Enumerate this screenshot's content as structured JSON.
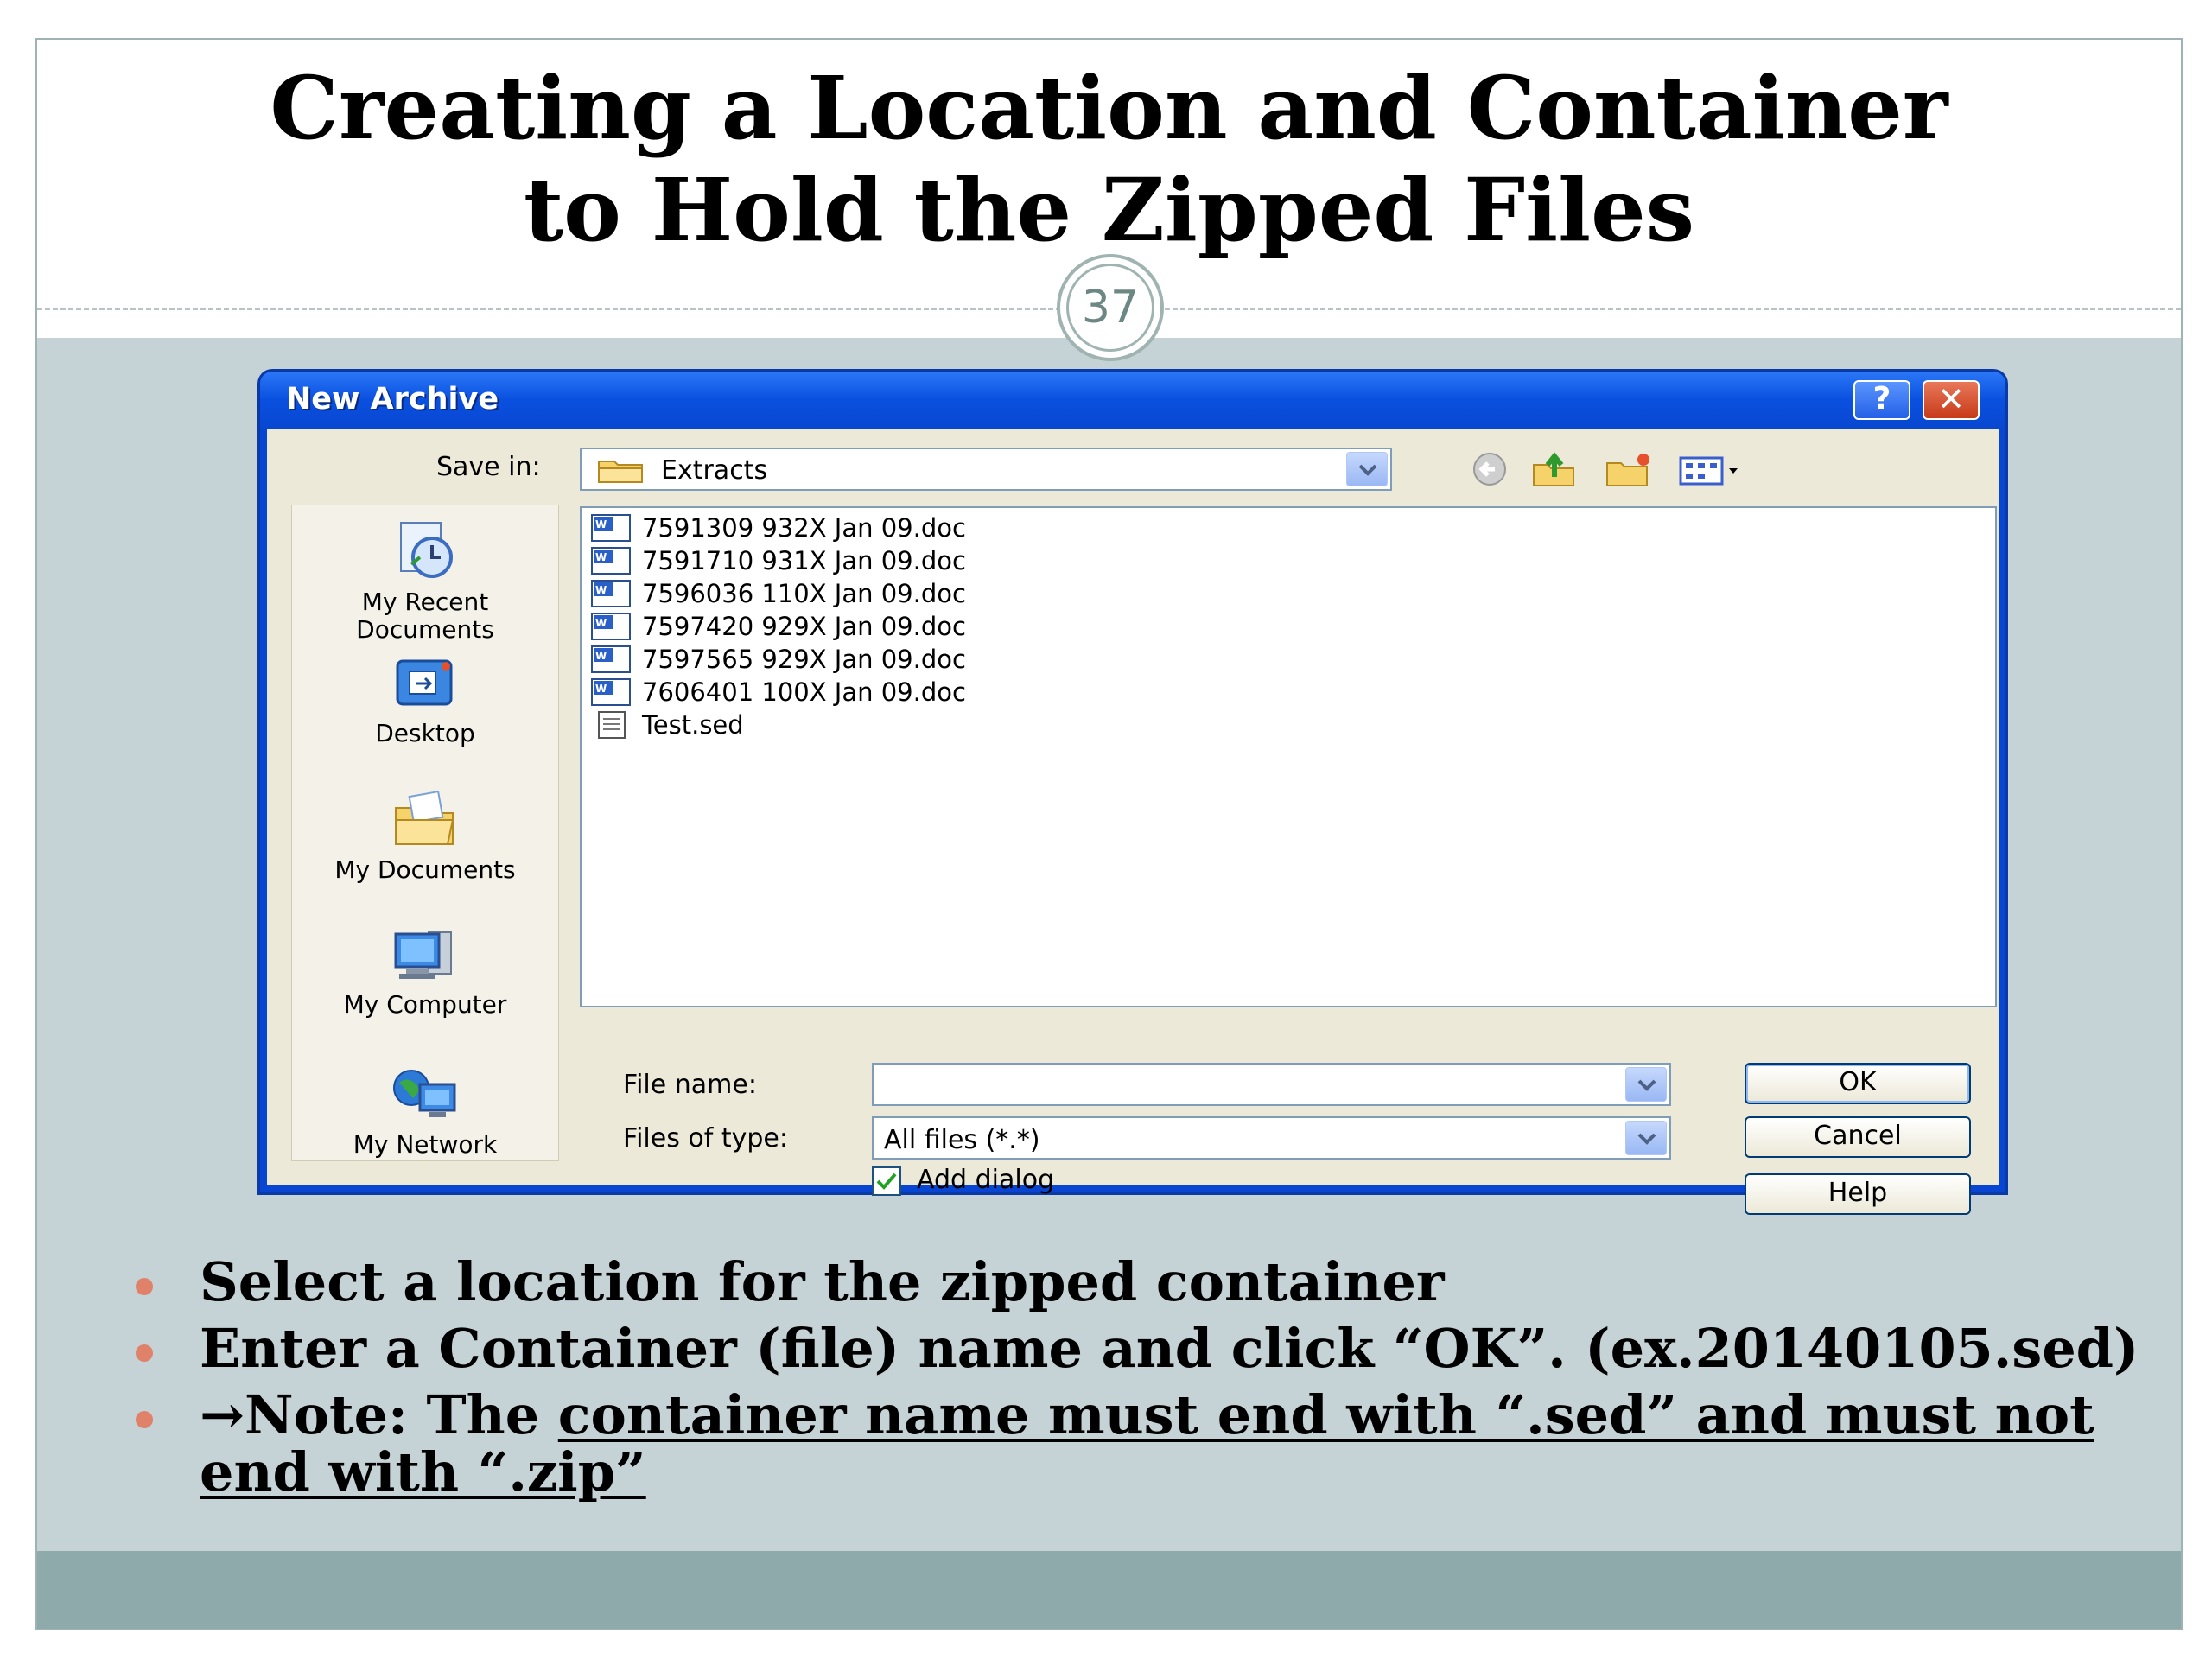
{
  "slide": {
    "title_line1": "Creating a Location and Container",
    "title_line2": "to Hold the Zipped Files",
    "page_number": "37"
  },
  "dialog": {
    "title": "New Archive",
    "help_glyph": "?",
    "close_glyph": "✕",
    "save_in_label": "Save in:",
    "save_in_value": "Extracts",
    "places": [
      {
        "line1": "My Recent",
        "line2": "Documents"
      },
      {
        "line1": "Desktop"
      },
      {
        "line1": "My Documents"
      },
      {
        "line1": "My Computer"
      },
      {
        "line1": "My Network"
      }
    ],
    "files": [
      "7591309 932X Jan 09.doc",
      "7591710 931X Jan 09.doc",
      "7596036 110X Jan 09.doc",
      "7597420 929X Jan 09.doc",
      "7597565 929X Jan 09.doc",
      "7606401 100X Jan 09.doc",
      "Test.sed"
    ],
    "file_name_label": "File name:",
    "file_name_value": "",
    "files_of_type_label": "Files of type:",
    "files_of_type_value": "All files (*.*)",
    "add_dialog_label": "Add dialog",
    "add_dialog_checked": true,
    "ok_label": "OK",
    "cancel_label": "Cancel",
    "help_label": "Help"
  },
  "bullets": {
    "b1": "Select a location for the zipped container",
    "b2": "Enter a Container (file) name and click “OK”.  (ex.20140105.sed)",
    "b3_prefix": "→Note: The ",
    "b3_underlined": "container name must end with “.sed” and must not end with “.zip”"
  },
  "colors": {
    "slide_bg": "#c5d2d6",
    "bottom_bar": "#8eaaaa",
    "bullet": "#e0826a",
    "titlebar": "#0a50e0"
  }
}
